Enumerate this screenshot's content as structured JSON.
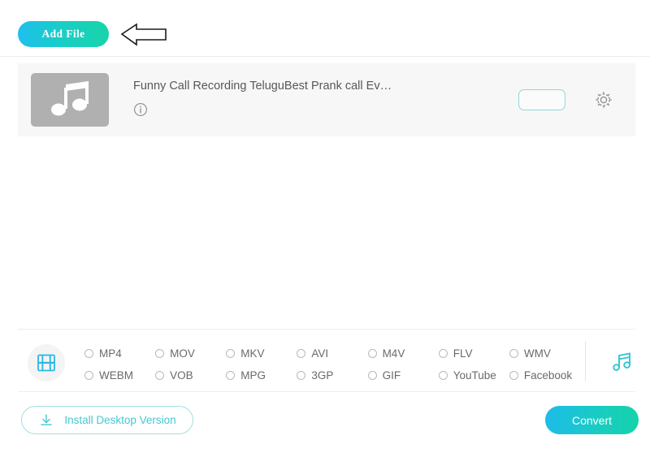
{
  "toolbar": {
    "add_file_label": "Add File",
    "annotation_icon": "left-arrow-pointer"
  },
  "file_list": {
    "items": [
      {
        "title": "Funny Call Recording TeluguBest Prank call Ev…",
        "thumbnail_icon": "music-note-icon",
        "info_icon": "info-circle-icon",
        "format_value": "",
        "settings_icon": "gear-icon"
      }
    ]
  },
  "format_bar": {
    "video_icon": "film-strip-icon",
    "audio_icon": "music-note-icon",
    "options": [
      {
        "label": "MP4",
        "selected": false
      },
      {
        "label": "MOV",
        "selected": false
      },
      {
        "label": "MKV",
        "selected": false
      },
      {
        "label": "AVI",
        "selected": false
      },
      {
        "label": "M4V",
        "selected": false
      },
      {
        "label": "FLV",
        "selected": false
      },
      {
        "label": "WMV",
        "selected": false
      },
      {
        "label": "WEBM",
        "selected": false
      },
      {
        "label": "VOB",
        "selected": false
      },
      {
        "label": "MPG",
        "selected": false
      },
      {
        "label": "3GP",
        "selected": false
      },
      {
        "label": "GIF",
        "selected": false
      },
      {
        "label": "YouTube",
        "selected": false
      },
      {
        "label": "Facebook",
        "selected": false
      }
    ]
  },
  "footer": {
    "install_label": "Install Desktop Version",
    "install_icon": "download-icon",
    "convert_label": "Convert"
  },
  "colors": {
    "accent_cyan": "#1ebce9",
    "accent_teal": "#17d2aa",
    "panel_gray": "#f7f7f7",
    "thumb_gray": "#b0b0b0",
    "text_gray": "#585858"
  }
}
